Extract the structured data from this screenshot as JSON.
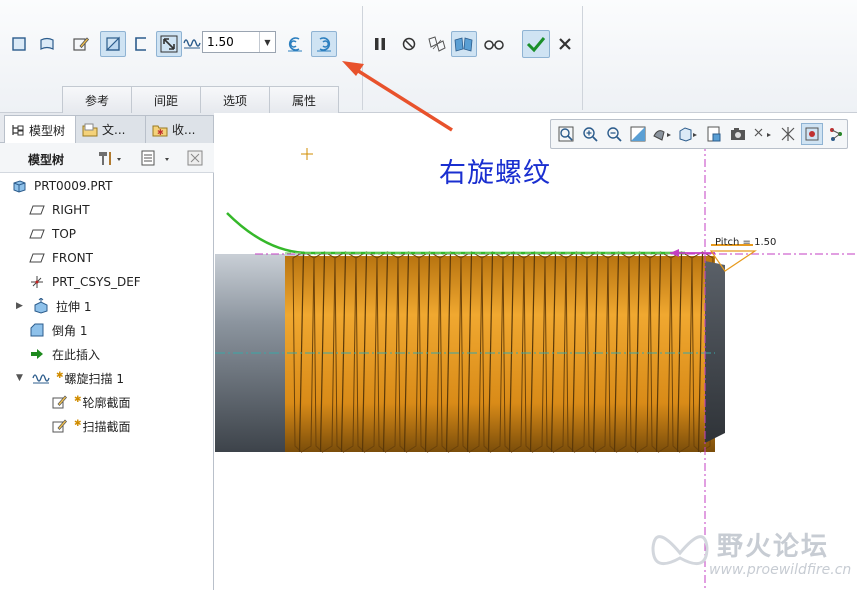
{
  "ribbon": {
    "pitch_value": "1.50",
    "tabs": [
      "参考",
      "间距",
      "选项",
      "属性"
    ]
  },
  "left_panel": {
    "tabs": [
      {
        "label": "模型树",
        "icon": "model-tree-icon"
      },
      {
        "label": "文...",
        "icon": "folder-browser-icon"
      },
      {
        "label": "收...",
        "icon": "favorites-icon"
      }
    ],
    "tree_title": "模型树",
    "tree_items": [
      {
        "label": "PRT0009.PRT",
        "icon": "part-icon",
        "star": false
      },
      {
        "label": "RIGHT",
        "icon": "datum-plane-icon",
        "star": false
      },
      {
        "label": "TOP",
        "icon": "datum-plane-icon",
        "star": false
      },
      {
        "label": "FRONT",
        "icon": "datum-plane-icon",
        "star": false
      },
      {
        "label": "PRT_CSYS_DEF",
        "icon": "coordinate-system-icon",
        "star": false
      },
      {
        "label": "拉伸 1",
        "icon": "extrude-icon",
        "star": false
      },
      {
        "label": "倒角 1",
        "icon": "chamfer-icon",
        "star": false
      },
      {
        "label": "在此插入",
        "icon": "insert-here-arrow-icon",
        "star": false
      },
      {
        "label": "螺旋扫描 1",
        "icon": "helical-sweep-icon",
        "star": true
      },
      {
        "label": "轮廓截面",
        "icon": "sketch-icon",
        "star": true
      },
      {
        "label": "扫描截面",
        "icon": "sketch-icon",
        "star": true
      }
    ]
  },
  "viewport": {
    "annotation": "右旋螺纹",
    "pitch_label": "Pitch = 1.50",
    "watermark": {
      "text": "野火论坛",
      "url": "www.proewildfire.cn"
    }
  },
  "colors": {
    "thread": "#e79a1e",
    "thread_dark": "#8a5a10",
    "shaft": "#8b949e",
    "annotation": "#1a2fd0",
    "trajectory": "#35b82a",
    "arrow": "#e8522c",
    "axis_line": "#c33fc3"
  }
}
